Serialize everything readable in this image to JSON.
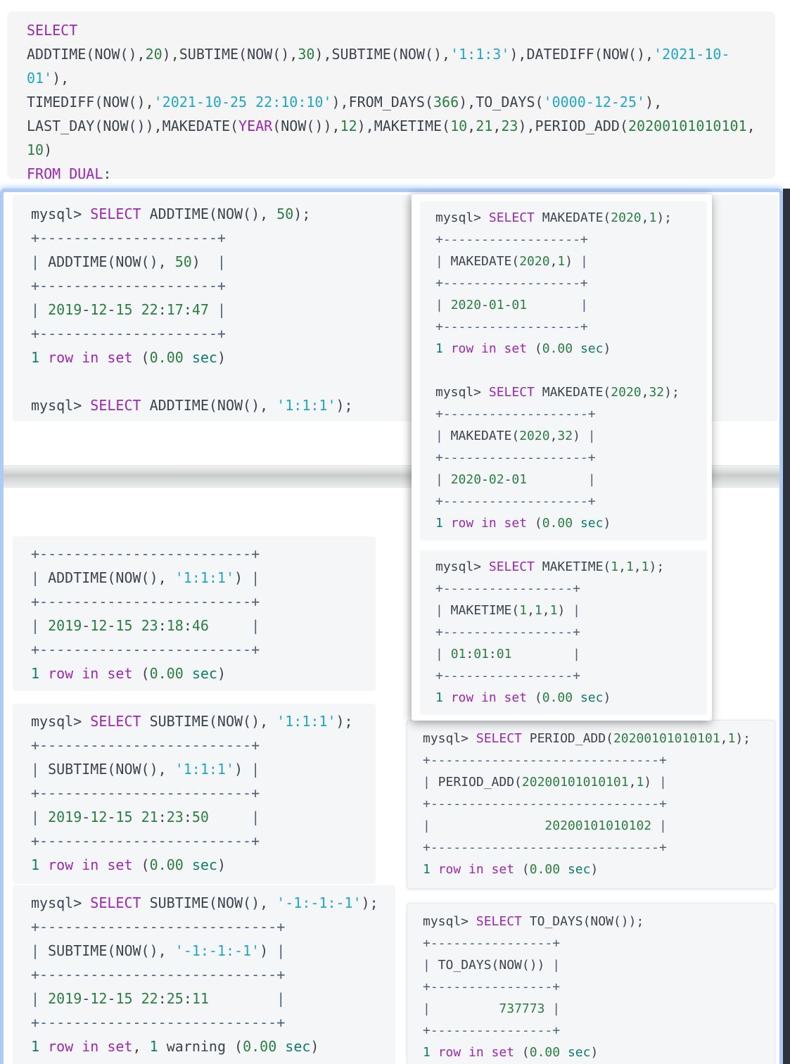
{
  "colors": {
    "keyword": "#9c27b0",
    "number": "#2a7e43",
    "string": "#1ea7c9",
    "plain": "#3c434e",
    "table_border": "#4a617c",
    "teal_literal": "#0b7c6e",
    "panel_bg": "#f5f6f7",
    "accent_border": "#aecbf5",
    "dark_edge": "#2d323d"
  },
  "sql_editor": {
    "lines": [
      "SELECT",
      "ADDTIME(NOW(),20),SUBTIME(NOW(),30),SUBTIME(NOW(),'1:1:3'),DATEDIFF(NOW(),'2021-10-",
      "01'),",
      "TIMEDIFF(NOW(),'2021-10-25 22:10:10'),FROM_DAYS(366),TO_DAYS('0000-12-25'),",
      "LAST_DAY(NOW()),MAKEDATE(YEAR(NOW()),12),MAKETIME(10,21,23),PERIOD_ADD(20200101010101,",
      "10)",
      "FROM DUAL;"
    ]
  },
  "terminal_top": {
    "lines": [
      "mysql> SELECT ADDTIME(NOW(), 50);",
      "+---------------------+",
      "| ADDTIME(NOW(), 50)  |",
      "+---------------------+",
      "| 2019-12-15 22:17:47 |",
      "+---------------------+",
      "1 row in set (0.00 sec)",
      "",
      "mysql> SELECT ADDTIME(NOW(), '1:1:1');"
    ]
  },
  "bottom_left_boxes": [
    {
      "lines": [
        "+-------------------------+",
        "| ADDTIME(NOW(), '1:1:1') |",
        "+-------------------------+",
        "| 2019-12-15 23:18:46     |",
        "+-------------------------+",
        "1 row in set (0.00 sec)"
      ]
    },
    {
      "lines": [
        "mysql> SELECT SUBTIME(NOW(), '1:1:1');",
        "+-------------------------+",
        "| SUBTIME(NOW(), '1:1:1') |",
        "+-------------------------+",
        "| 2019-12-15 21:23:50     |",
        "+-------------------------+",
        "1 row in set (0.00 sec)"
      ]
    },
    {
      "lines": [
        "mysql> SELECT SUBTIME(NOW(), '-1:-1:-1');",
        "+----------------------------+",
        "| SUBTIME(NOW(), '-1:-1:-1') |",
        "+----------------------------+",
        "| 2019-12-15 22:25:11        |",
        "+----------------------------+",
        "1 row in set, 1 warning (0.00 sec)"
      ]
    }
  ],
  "overlay_panel": {
    "boxes": [
      {
        "lines": [
          "mysql> SELECT MAKEDATE(2020,1);",
          "+------------------+",
          "| MAKEDATE(2020,1) |",
          "+------------------+",
          "| 2020-01-01       |",
          "+------------------+",
          "1 row in set (0.00 sec)",
          "",
          "mysql> SELECT MAKEDATE(2020,32);",
          "+-------------------+",
          "| MAKEDATE(2020,32) |",
          "+-------------------+",
          "| 2020-02-01        |",
          "+-------------------+",
          "1 row in set (0.00 sec)"
        ]
      },
      {
        "lines": [
          "mysql> SELECT MAKETIME(1,1,1);",
          "+-----------------+",
          "| MAKETIME(1,1,1) |",
          "+-----------------+",
          "| 01:01:01        |",
          "+-----------------+",
          "1 row in set (0.00 sec)"
        ]
      }
    ]
  },
  "bottom_right_boxes": [
    {
      "lines": [
        "mysql> SELECT PERIOD_ADD(20200101010101,1);",
        "+------------------------------+",
        "| PERIOD_ADD(20200101010101,1) |",
        "+------------------------------+",
        "|               20200101010102 |",
        "+------------------------------+",
        "1 row in set (0.00 sec)"
      ]
    },
    {
      "lines": [
        "mysql> SELECT TO_DAYS(NOW());",
        "+----------------+",
        "| TO_DAYS(NOW()) |",
        "+----------------+",
        "|         737773 |",
        "+----------------+",
        "1 row in set (0.00 sec)"
      ]
    }
  ]
}
